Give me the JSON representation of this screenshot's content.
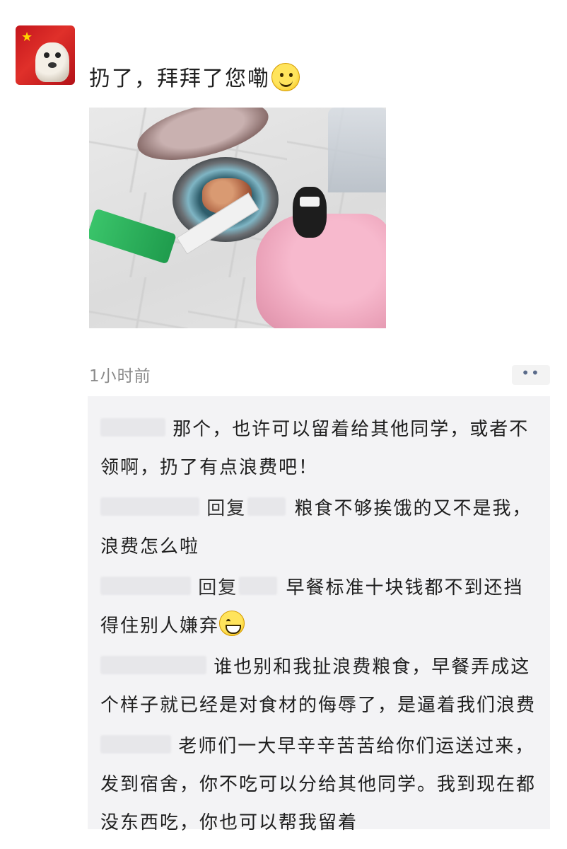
{
  "post": {
    "text": "扔了，拜拜了您嘞",
    "emoji": "smile-emoji"
  },
  "meta": {
    "time": "1小时前",
    "more": "••"
  },
  "comments": [
    {
      "reply_verb": "",
      "text": "那个，也许可以留着给其他同学，或者不领啊，扔了有点浪费吧！"
    },
    {
      "reply_verb": "回复",
      "text": "粮食不够挨饿的又不是我，浪费怎么啦"
    },
    {
      "reply_verb": "回复",
      "text": "早餐标准十块钱都不到还挡得住别人嫌弃",
      "emoji": "grin-emoji"
    },
    {
      "reply_verb": "",
      "text": "谁也别和我扯浪费粮食，早餐弄成这个样子就已经是对食材的侮辱了，是逼着我们浪费"
    },
    {
      "reply_verb": "",
      "text": "老师们一大早辛辛苦苦给你们运送过来，发到宿舍，你不吃可以分给其他同学。我到现在都没东西吃，你也可以帮我留着"
    }
  ]
}
